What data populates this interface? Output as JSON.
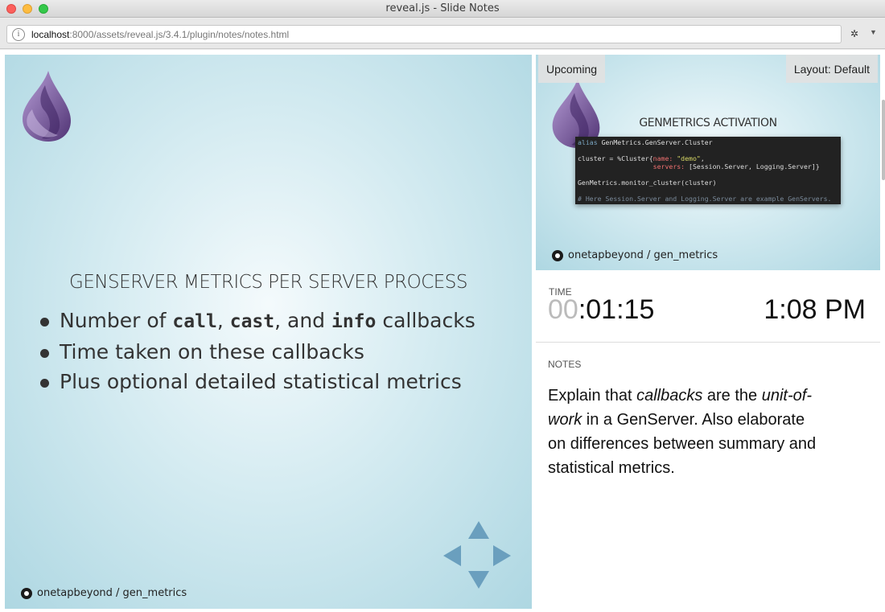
{
  "window": {
    "title": "reveal.js - Slide Notes"
  },
  "address_bar": {
    "host": "localhost",
    "path": ":8000/assets/reveal.js/3.4.1/plugin/notes/notes.html"
  },
  "current_slide": {
    "title": "GENSERVER METRICS PER SERVER PROCESS",
    "bullets": {
      "b1_pre": "Number of ",
      "b1_code1": "call",
      "b1_sep1": ", ",
      "b1_code2": "cast",
      "b1_sep2": ", and ",
      "b1_code3": "info",
      "b1_post": " callbacks",
      "b2": "Time taken on these callbacks",
      "b3": "Plus optional detailed statistical metrics"
    },
    "footer": "onetapbeyond / gen_metrics"
  },
  "upcoming": {
    "label": "Upcoming",
    "layout_button": "Layout: Default",
    "title": "GENMETRICS ACTIVATION",
    "code": {
      "l1_kw": "alias",
      "l1_rest": " GenMetrics.GenServer.Cluster",
      "l2_pre": "cluster = %Cluster{",
      "l2_atom": "name:",
      "l2_str": " \"demo\"",
      "l2_post": ",",
      "l3_pad": "                   ",
      "l3_atom": "servers:",
      "l3_rest": " [Session.Server, Logging.Server]}",
      "l4": "GenMetrics.monitor_cluster(cluster)",
      "l5": "# Here Session.Server and Logging.Server are example GenServers."
    },
    "footer": "onetapbeyond / gen_metrics"
  },
  "timer": {
    "label": "TIME",
    "hours": "00",
    "rest": ":01:15",
    "clock": "1:08 PM"
  },
  "notes": {
    "label": "NOTES",
    "t1": "Explain that ",
    "t1_em": "callbacks",
    "t2": " are the ",
    "t3_em": "unit-of-work",
    "t4": " in a GenServer. Also elaborate on differences between summary and statistical metrics."
  },
  "colors": {
    "slide_bg": "#aed7e2",
    "control_arrow": "#6a9fbe",
    "drop_purple": "#6b4e8f"
  }
}
